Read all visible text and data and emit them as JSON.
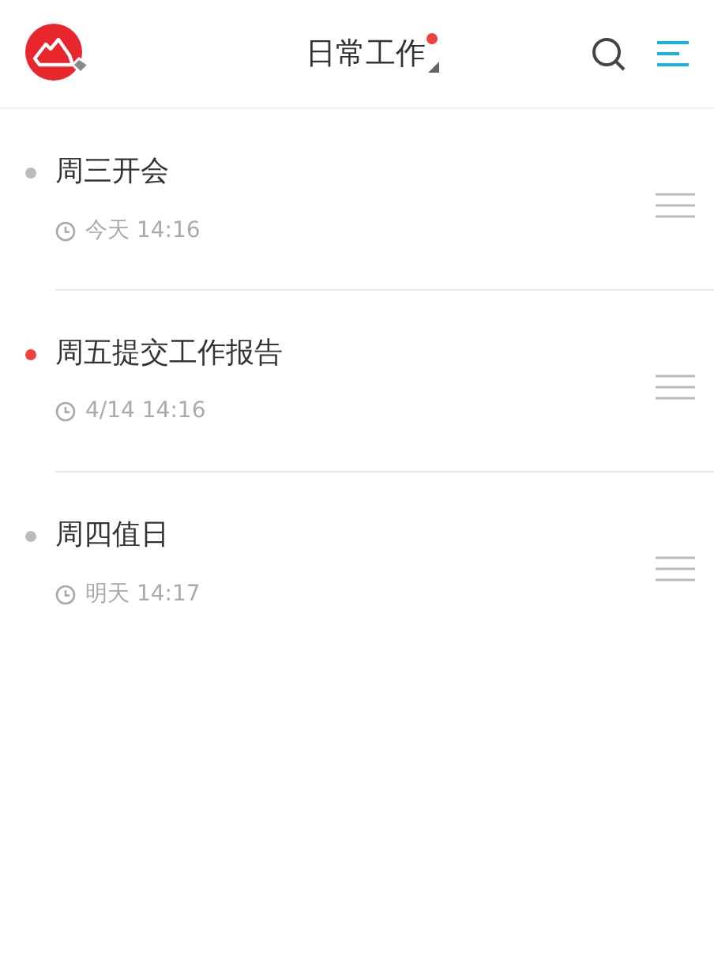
{
  "header": {
    "title": "日常工作",
    "notification": true
  },
  "tasks": [
    {
      "title": "周三开会",
      "time": "今天 14:16",
      "color": "#bbbbbb"
    },
    {
      "title": "周五提交工作报告",
      "time": "4/14 14:16",
      "color": "#f04040"
    },
    {
      "title": "周四值日",
      "time": "明天 14:17",
      "color": "#bbbbbb"
    }
  ]
}
